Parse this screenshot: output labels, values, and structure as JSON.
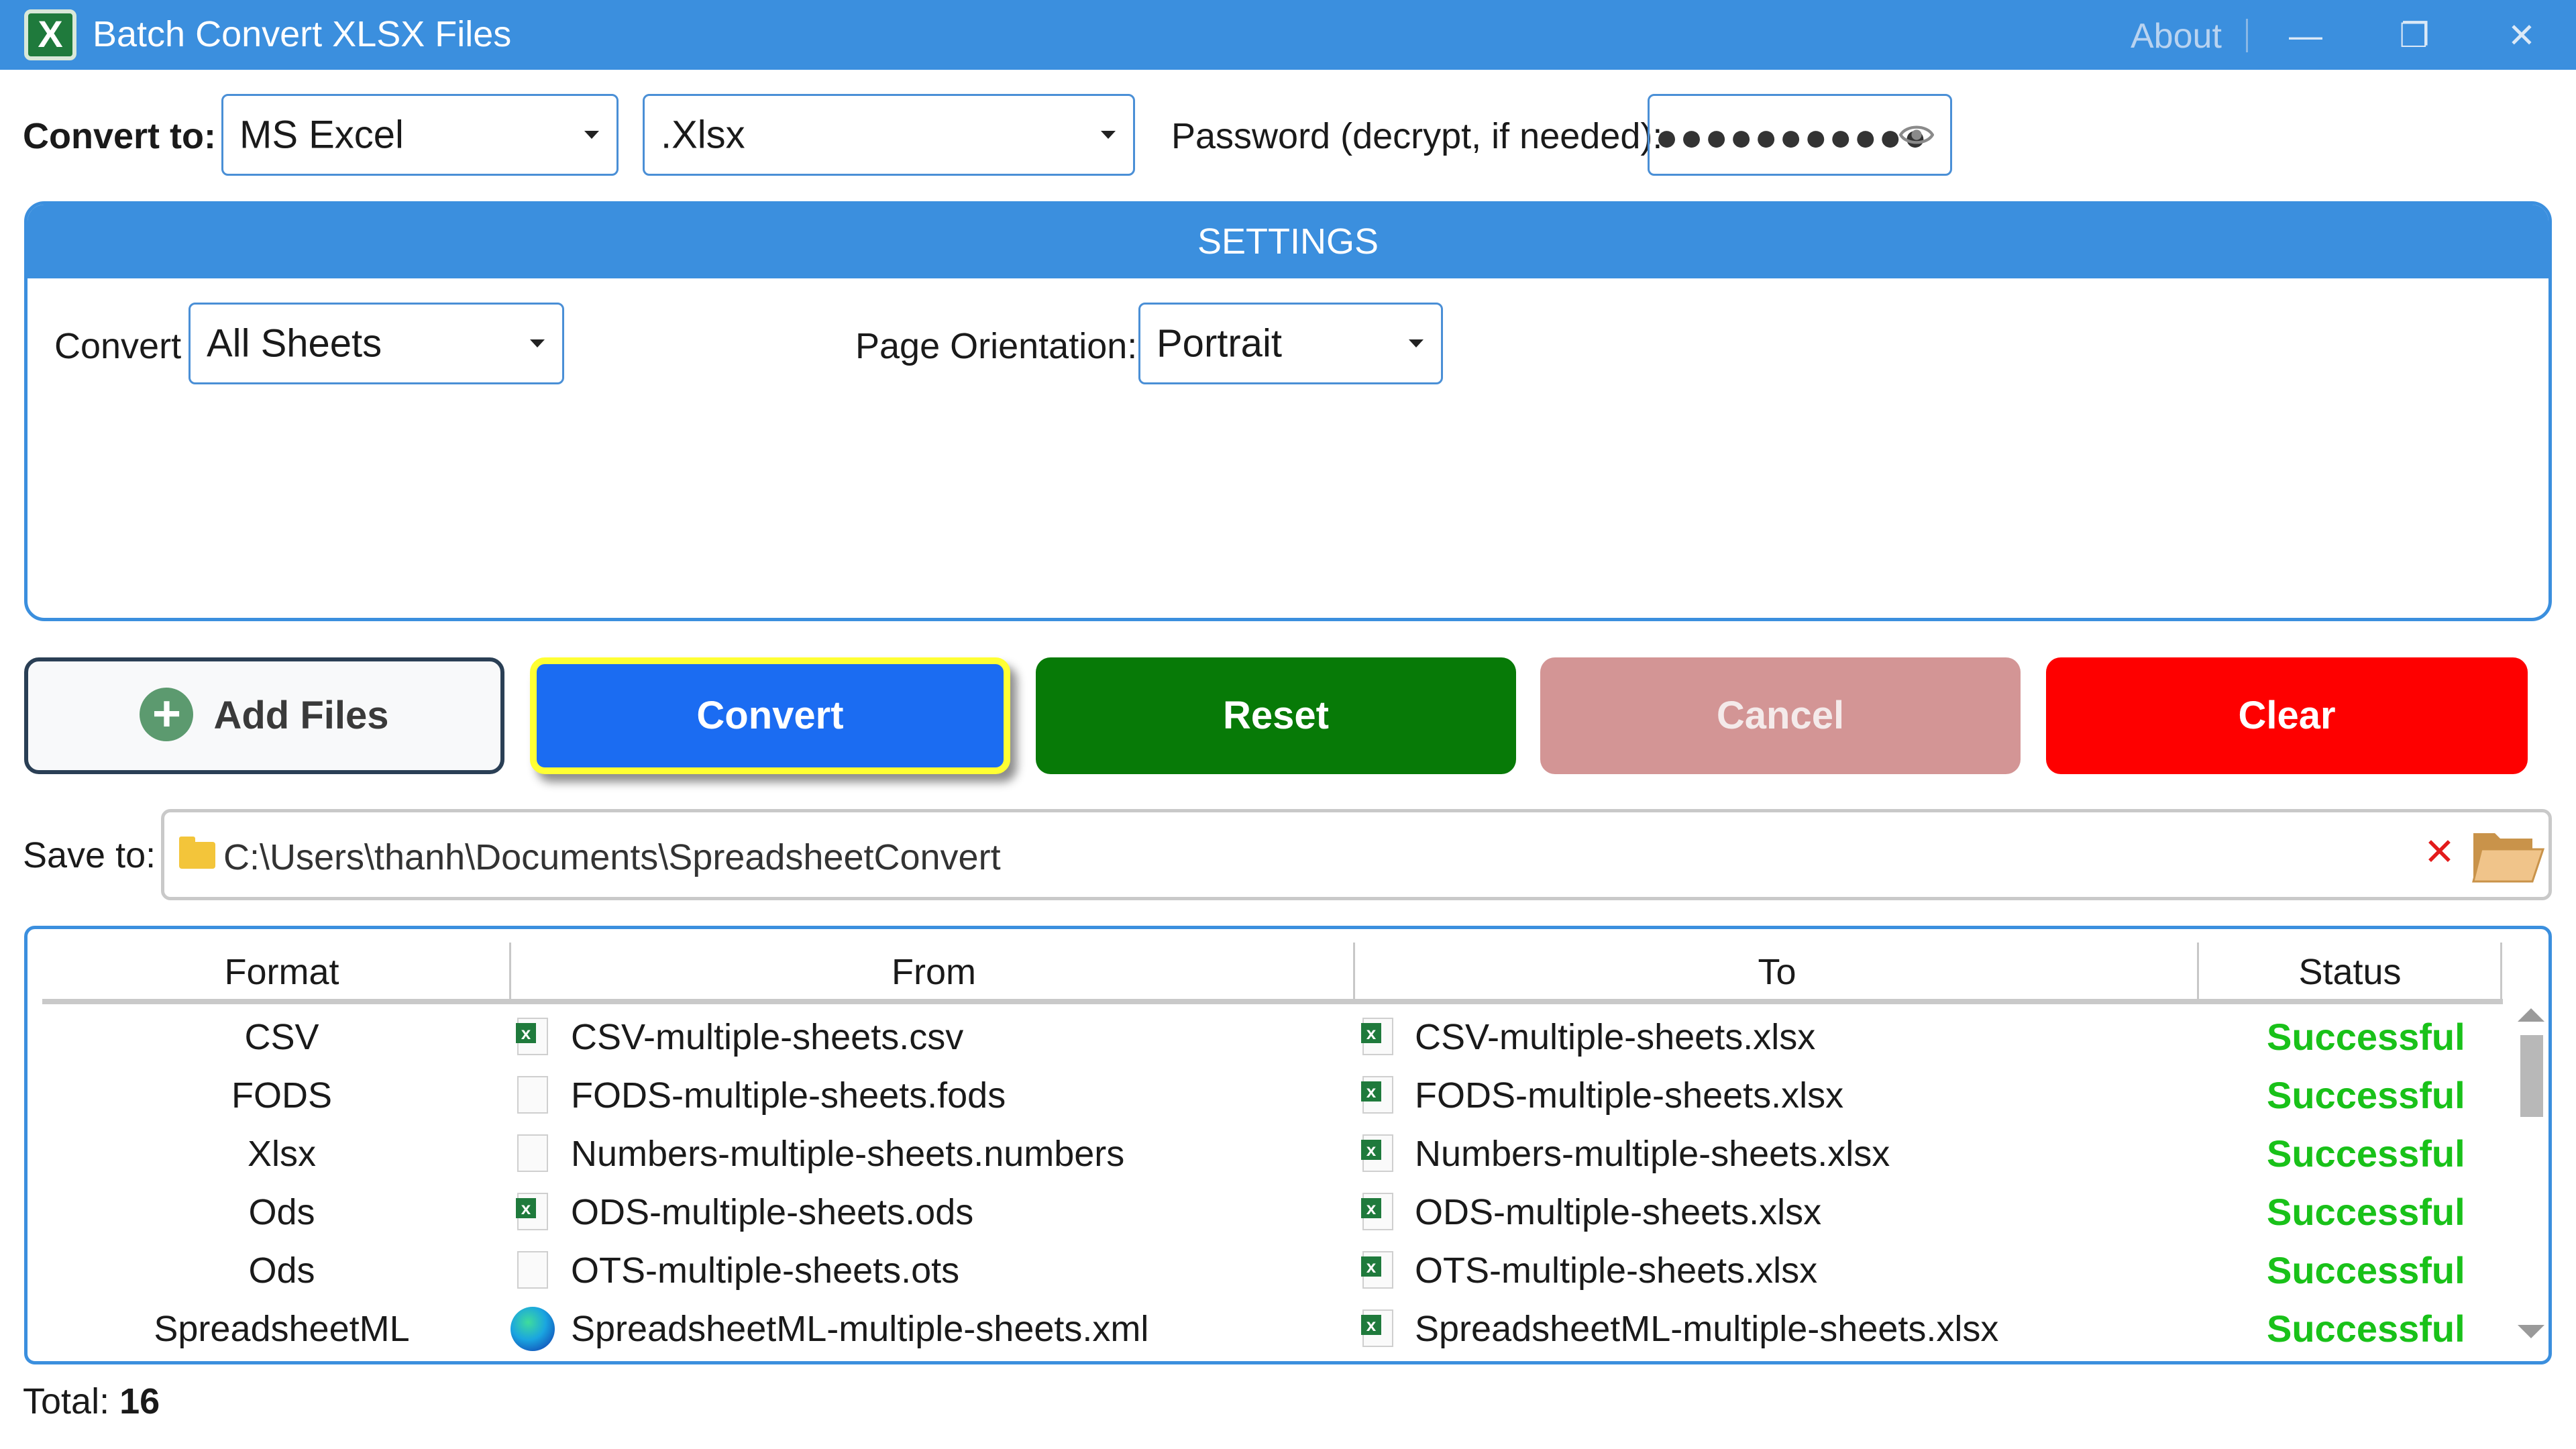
{
  "window": {
    "title": "Batch Convert XLSX Files",
    "about_label": "About",
    "app_icon": "excel-icon"
  },
  "top": {
    "convert_to_label": "Convert to:",
    "format_value": "MS Excel",
    "extension_value": ".Xlsx",
    "password_label": "Password (decrypt, if needed):",
    "password_masked": "●●●●●●●●●●●"
  },
  "settings": {
    "header": "SETTINGS",
    "convert_label": "Convert",
    "convert_value": "All Sheets",
    "orientation_label": "Page Orientation:",
    "orientation_value": "Portrait"
  },
  "buttons": {
    "add_files": "Add Files",
    "convert": "Convert",
    "reset": "Reset",
    "cancel": "Cancel",
    "clear": "Clear"
  },
  "save": {
    "label": "Save to:",
    "path": "C:\\Users\\thanh\\Documents\\SpreadsheetConvert"
  },
  "table": {
    "headers": [
      "Format",
      "From",
      "To",
      "Status"
    ],
    "rows": [
      {
        "format": "CSV",
        "from": "CSV-multiple-sheets.csv",
        "to": "CSV-multiple-sheets.xlsx",
        "status": "Successful",
        "from_icon": "excel-csv-icon"
      },
      {
        "format": "FODS",
        "from": "FODS-multiple-sheets.fods",
        "to": "FODS-multiple-sheets.xlsx",
        "status": "Successful",
        "from_icon": "blank-file-icon"
      },
      {
        "format": "Xlsx",
        "from": "Numbers-multiple-sheets.numbers",
        "to": "Numbers-multiple-sheets.xlsx",
        "status": "Successful",
        "from_icon": "blank-file-icon"
      },
      {
        "format": "Ods",
        "from": "ODS-multiple-sheets.ods",
        "to": "ODS-multiple-sheets.xlsx",
        "status": "Successful",
        "from_icon": "excel-ods-icon"
      },
      {
        "format": "Ods",
        "from": "OTS-multiple-sheets.ots",
        "to": "OTS-multiple-sheets.xlsx",
        "status": "Successful",
        "from_icon": "blank-file-icon"
      },
      {
        "format": "SpreadsheetML",
        "from": "SpreadsheetML-multiple-sheets.xml",
        "to": "SpreadsheetML-multiple-sheets.xlsx",
        "status": "Successful",
        "from_icon": "edge-icon"
      }
    ]
  },
  "footer": {
    "total_label": "Total:",
    "total_value": "16"
  },
  "colors": {
    "accent": "#3b8fde",
    "convert_btn": "#1b6cf2",
    "reset_btn": "#077a07",
    "cancel_btn": "#d39595",
    "clear_btn": "#fe0000",
    "success_text": "#19c119"
  }
}
